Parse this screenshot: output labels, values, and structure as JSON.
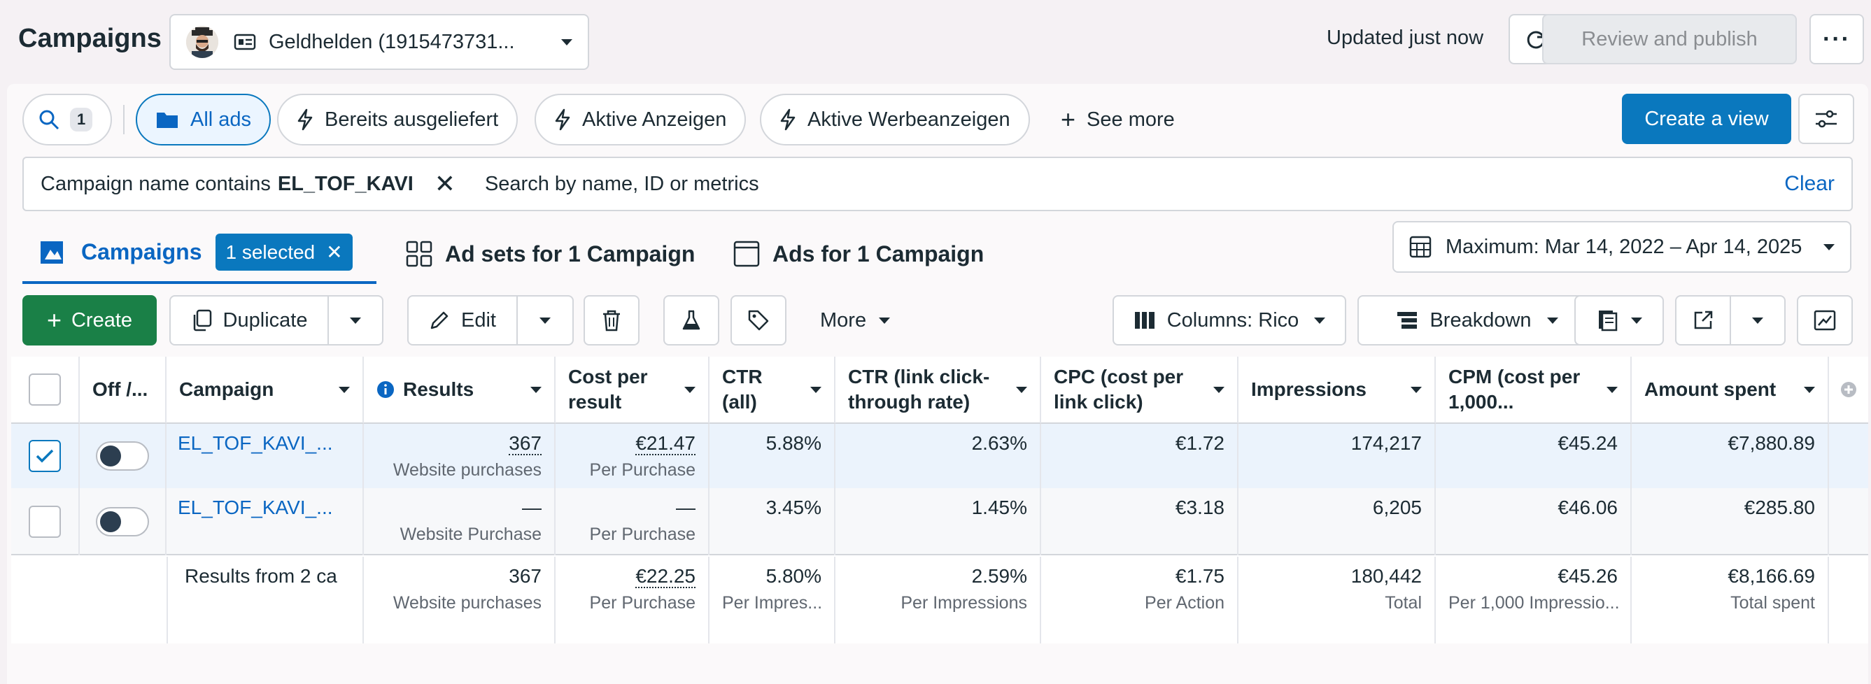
{
  "header": {
    "title": "Campaigns",
    "account_name": "Geldhelden (1915473731...",
    "updated_text": "Updated just now",
    "review_publish_label": "Review and publish"
  },
  "views": {
    "search_count": "1",
    "pills": [
      {
        "label": "All ads"
      },
      {
        "label": "Bereits ausgeliefert"
      },
      {
        "label": "Aktive Anzeigen"
      },
      {
        "label": "Aktive Werbeanzeigen"
      }
    ],
    "see_more_label": "See more",
    "create_view_label": "Create a view"
  },
  "filter": {
    "prefix": "Campaign name contains",
    "value": "EL_TOF_KAVI",
    "search_placeholder": "Search by name, ID or metrics",
    "clear_label": "Clear"
  },
  "tabs": {
    "campaigns_label": "Campaigns",
    "selected_badge": "1 selected",
    "adsets_label": "Ad sets for 1 Campaign",
    "ads_label": "Ads for 1 Campaign"
  },
  "date_range": "Maximum: Mar 14, 2022 – Apr 14, 2025",
  "toolbar": {
    "create_label": "Create",
    "duplicate_label": "Duplicate",
    "edit_label": "Edit",
    "more_label": "More",
    "columns_label": "Columns: Rico",
    "breakdown_label": "Breakdown"
  },
  "table": {
    "headers": {
      "off": "Off /...",
      "campaign": "Campaign",
      "results": "Results",
      "cost_per_result": "Cost per result",
      "ctr_all": "CTR (all)",
      "ctr_link": "CTR (link click-through rate)",
      "cpc": "CPC (cost per link click)",
      "impressions": "Impressions",
      "cpm": "CPM (cost per 1,000...",
      "amount_spent": "Amount spent"
    },
    "rows": [
      {
        "name": "EL_TOF_KAVI_...",
        "results": "367",
        "results_sub": "Website purchases",
        "cost": "€21.47",
        "cost_sub": "Per Purchase",
        "ctr_all": "5.88%",
        "ctr_link": "2.63%",
        "cpc": "€1.72",
        "impressions": "174,217",
        "cpm": "€45.24",
        "spent": "€7,880.89"
      },
      {
        "name": "EL_TOF_KAVI_...",
        "results": "—",
        "results_sub": "Website Purchase",
        "cost": "—",
        "cost_sub": "Per Purchase",
        "ctr_all": "3.45%",
        "ctr_link": "1.45%",
        "cpc": "€3.18",
        "impressions": "6,205",
        "cpm": "€46.06",
        "spent": "€285.80"
      }
    ],
    "totals": {
      "label": "Results from 2 ca",
      "results": "367",
      "results_sub": "Website purchases",
      "cost": "€22.25",
      "cost_sub": "Per Purchase",
      "ctr_all": "5.80%",
      "ctr_all_sub": "Per Impres...",
      "ctr_link": "2.59%",
      "ctr_link_sub": "Per Impressions",
      "cpc": "€1.75",
      "cpc_sub": "Per Action",
      "impressions": "180,442",
      "impressions_sub": "Total",
      "cpm": "€45.26",
      "cpm_sub": "Per 1,000 Impressio...",
      "spent": "€8,166.69",
      "spent_sub": "Total spent"
    }
  },
  "colors": {
    "accent": "#0a78be",
    "create_green": "#1a8047",
    "link": "#0a66c2"
  }
}
